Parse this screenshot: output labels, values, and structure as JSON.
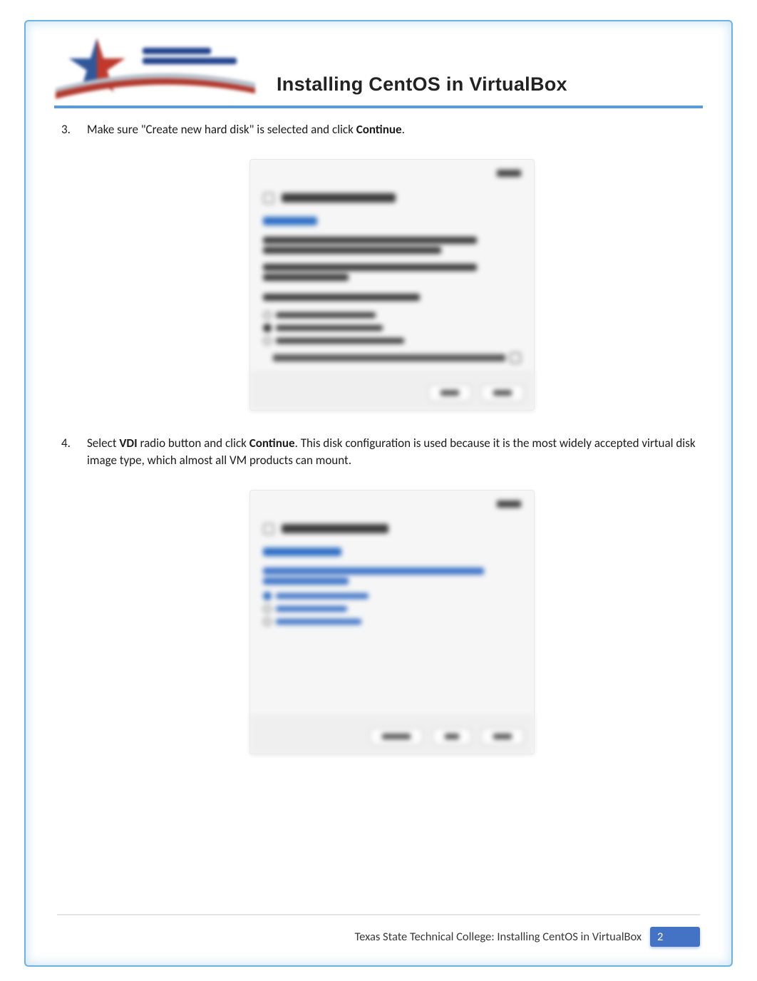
{
  "header": {
    "logo_name": "Texas State Technical College",
    "doc_title": "Installing CentOS in VirtualBox"
  },
  "steps": [
    {
      "n": 3,
      "pre": "Make sure \"Create new hard disk\" is selected and click ",
      "bold": "Continue",
      "post": "."
    },
    {
      "n": 4,
      "pre": "Select ",
      "bold1": "VDI",
      "mid": " radio button and click ",
      "bold2": "Continue",
      "post": ".  This disk configuration is used because it is the most widely accepted virtual disk image type, which almost all VM products can mount."
    }
  ],
  "dialog1": {
    "title": "Create Virtual Machine",
    "section": "Hard disk",
    "options": [
      "Do not add a virtual hard disk",
      "Create a virtual hard disk now",
      "Use an existing virtual hard disk file"
    ],
    "selected_index": 1,
    "buttons": [
      "Cancel",
      "Create"
    ]
  },
  "dialog2": {
    "title": "Create Virtual Hard Disk",
    "section": "Hard disk file type",
    "options": [
      "VDI (VirtualBox Disk Image)",
      "VHD (Virtual Hard Disk)",
      "VMDK (Virtual Machine Disk)"
    ],
    "selected_index": 0,
    "buttons": [
      "Expert Mode",
      "Back",
      "Continue"
    ]
  },
  "footer": {
    "text": "Texas State Technical College:   Installing CentOS in VirtualBox",
    "page": "2"
  }
}
